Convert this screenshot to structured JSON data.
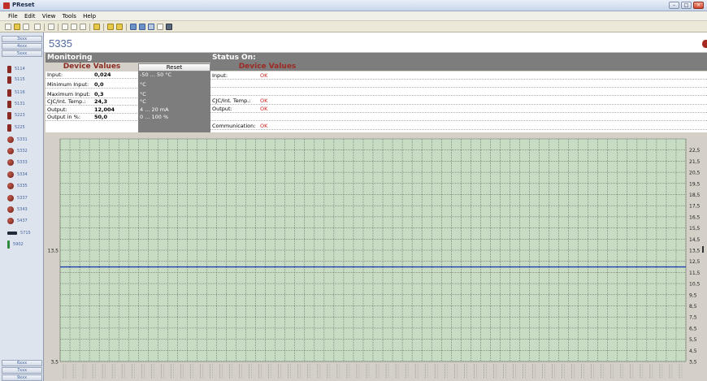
{
  "app": {
    "title": "PReset"
  },
  "window_buttons": [
    "–",
    "□",
    "×"
  ],
  "menu": [
    "File",
    "Edit",
    "View",
    "Tools",
    "Help"
  ],
  "sidebar": {
    "top_buttons": [
      "3xxx",
      "4xxx",
      "5xxx"
    ],
    "bottom_buttons": [
      "6xxx",
      "7xxx",
      "9xxx"
    ],
    "items": [
      {
        "label": "5114",
        "icon": "rect"
      },
      {
        "label": "5115",
        "icon": "rect"
      },
      {
        "label": "5116",
        "icon": "rect"
      },
      {
        "label": "5131",
        "icon": "rect"
      },
      {
        "label": "5223",
        "icon": "rect"
      },
      {
        "label": "5225",
        "icon": "rect"
      },
      {
        "label": "5331",
        "icon": "round"
      },
      {
        "label": "5332",
        "icon": "round"
      },
      {
        "label": "5333",
        "icon": "round"
      },
      {
        "label": "5334",
        "icon": "round"
      },
      {
        "label": "5335",
        "icon": "round"
      },
      {
        "label": "5337",
        "icon": "round"
      },
      {
        "label": "5343",
        "icon": "round"
      },
      {
        "label": "5437",
        "icon": "round"
      },
      {
        "label": "5715",
        "icon": "bar"
      },
      {
        "label": "5902",
        "icon": "green"
      }
    ]
  },
  "device": {
    "title": "5335"
  },
  "monitoring": {
    "heading": "Monitoring",
    "device_values_title": "Device Values",
    "reset_label": "Reset",
    "rows": [
      {
        "label": "Input:",
        "value": "0,024",
        "unit": "-50 ... 50 °C"
      },
      {
        "label": "Minimum Input:",
        "value": "0,0",
        "unit": "°C"
      },
      {
        "label": "Maximum Input:",
        "value": "0,3",
        "unit": "°C"
      },
      {
        "label": "CJC/Int. Temp.:",
        "value": "24,3",
        "unit": "°C"
      },
      {
        "label": "Output:",
        "value": "12,004",
        "unit": "4 ... 20 mA"
      },
      {
        "label": "Output in %:",
        "value": "50,0",
        "unit": "0 ... 100 %"
      }
    ]
  },
  "status": {
    "heading": "Status On:",
    "device_values_title": "Device Values",
    "rows": [
      {
        "label": "Input:",
        "value": "OK"
      },
      {
        "label": "",
        "value": ""
      },
      {
        "label": "",
        "value": ""
      },
      {
        "label": "CJC/Int. Temp.:",
        "value": "OK"
      },
      {
        "label": "Output:",
        "value": "OK"
      },
      {
        "label": "",
        "value": ""
      },
      {
        "label": "Communication:",
        "value": "OK"
      }
    ]
  },
  "chart_data": {
    "type": "line",
    "y_right_ticks": [
      "22,5",
      "21,5",
      "20,5",
      "19,5",
      "18,5",
      "17,5",
      "16,5",
      "15,5",
      "14,5",
      "13,5",
      "12,5",
      "11,5",
      "10,5",
      "9,5",
      "8,5",
      "7,5",
      "6,5",
      "5,5",
      "4,5",
      "3,5"
    ],
    "y_left_ticks": [
      "13,5",
      "3,5"
    ],
    "ylim": [
      3.5,
      23.5
    ],
    "x_tick_count": 64,
    "x_tick_labels": "illegible time stamps",
    "series": [
      {
        "values": [
          12.0,
          12.0
        ],
        "color": "#1f3fb0"
      }
    ],
    "grid": true,
    "background": "#c8dcc4",
    "grid_color": "#4a4a4a"
  },
  "colors": {
    "header_gray": "#7d7d7d",
    "status_ok": "#c8241e",
    "device_values": "#8a2a22",
    "device_title": "#4f6aa0"
  }
}
